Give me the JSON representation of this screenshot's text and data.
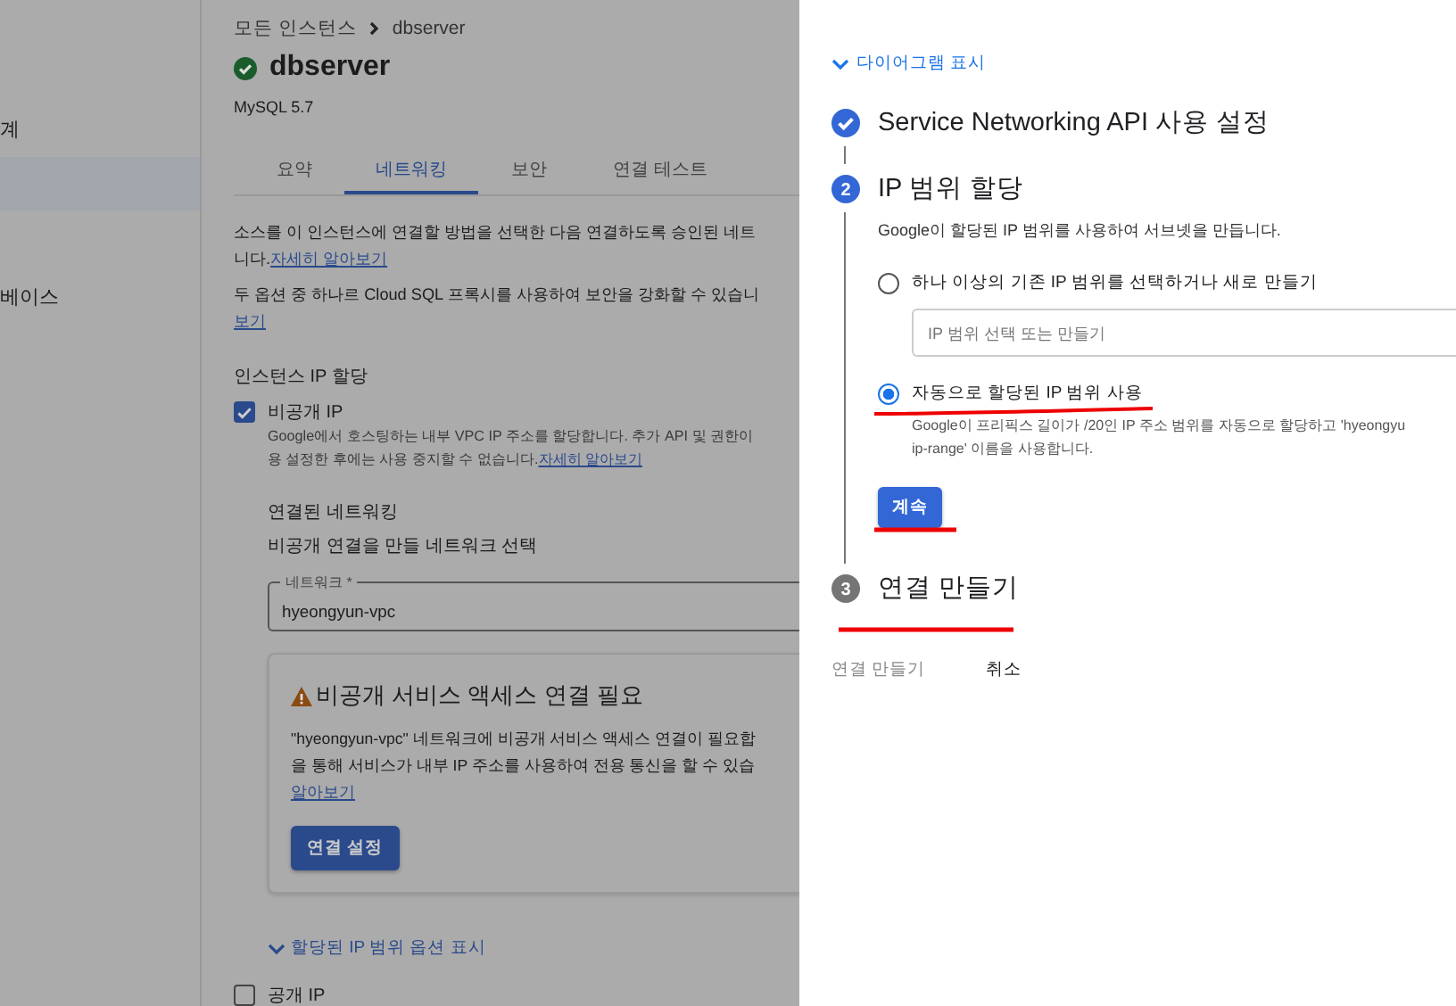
{
  "sidebar": {
    "items": [
      {
        "label": "계"
      },
      {
        "label": "베이스"
      }
    ]
  },
  "breadcrumb": [
    "모든 인스턴스",
    "dbserver"
  ],
  "instance": {
    "name": "dbserver",
    "version": "MySQL 5.7"
  },
  "tabs": [
    {
      "label": "요약",
      "selected": false
    },
    {
      "label": "네트워킹",
      "selected": true
    },
    {
      "label": "보안",
      "selected": false
    },
    {
      "label": "연결 테스트",
      "selected": false
    }
  ],
  "intro": [
    {
      "lines": [
        "소스를 이 인스턴스에 연결할 방법을 선택한 다음 연결하도록 승인된 네트",
        "니다."
      ],
      "link": "자세히 알아보기"
    },
    {
      "lines": [
        "두 옵션 중 하나르 Cloud SQL 프록시를 사용하여 보안을 강화할 수 있습니"
      ],
      "link": "보기"
    }
  ],
  "ip_assignment": {
    "title": "인스턴스 IP 할당",
    "private_ip": {
      "label": "비공개 IP",
      "checked": true,
      "lines": [
        "Google에서 호스팅하는 내부 VPC IP 주소를 할당합니다. 추가 API 및 권한이",
        "용 설정한 후에는 사용 중지할 수 없습니다."
      ],
      "link": "자세히 알아보기"
    },
    "connected_networking": {
      "title": "연결된 네트워킹",
      "subtitle": "비공개 연결을 만들 네트워크 선택",
      "field_label": "네트워크 *",
      "value": "hyeongyun-vpc"
    },
    "warning": {
      "title": "비공개 서비스 액세스 연결 필요",
      "lines": [
        "\"hyeongyun-vpc\" 네트워크에 비공개 서비스 액세스 연결이 필요합",
        "을 통해 서비스가 내부 IP 주소를 사용하여 전용 통신을 할 수 있습"
      ],
      "link": "알아보기",
      "button": "연결 설정"
    },
    "expand_link": "할당된 IP 범위 옵션 표시",
    "public_ip": {
      "label": "공개 IP",
      "checked": false
    }
  },
  "panel": {
    "diagram_link": "다이어그램 표시",
    "steps": [
      {
        "title": "Service Networking API 사용 설정",
        "completed": true,
        "disabled": false
      },
      {
        "number": "2",
        "title": "IP 범위 할당",
        "completed": false,
        "disabled": false
      },
      {
        "number": "3",
        "title": "연결 만들기",
        "completed": false,
        "disabled": true
      }
    ],
    "step2": {
      "description": "Google이 할당된 IP 범위를 사용하여 서브넷을 만듭니다.",
      "options": [
        {
          "label": "하나 이상의 기존 IP 범위를 선택하거나 새로 만들기",
          "selected": false,
          "placeholder": "IP 범위 선택 또는 만들기"
        },
        {
          "label": "자동으로 할당된 IP 범위 사용",
          "selected": true,
          "lines": [
            "Google이 프리픽스 길이가 /20인 IP 주소 범위를 자동으로 할당하고 'hyeongyu",
            "ip-range' 이름을 사용합니다."
          ]
        }
      ],
      "button": "계속"
    },
    "footer": [
      {
        "label": "연결 만들기",
        "disabled": true
      },
      {
        "label": "취소",
        "disabled": false
      }
    ]
  }
}
